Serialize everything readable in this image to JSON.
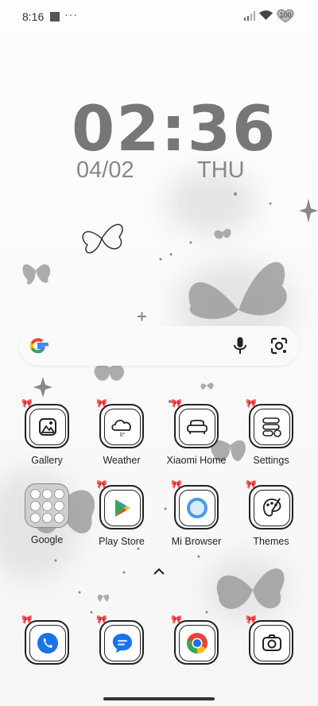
{
  "status_bar": {
    "time": "8:16",
    "more": "···",
    "battery": "100"
  },
  "clock": {
    "time": "02:36",
    "date": "04/02",
    "day": "THU"
  },
  "apps": [
    {
      "label": "Gallery"
    },
    {
      "label": "Weather",
      "temp": "0°"
    },
    {
      "label": "Xiaomi Home"
    },
    {
      "label": "Settings"
    },
    {
      "label": "Google"
    },
    {
      "label": "Play Store"
    },
    {
      "label": "Mi Browser"
    },
    {
      "label": "Themes"
    }
  ],
  "icon_names": [
    "google-g-icon",
    "mic-icon",
    "lens-icon",
    "phone-icon",
    "messages-icon",
    "chrome-icon",
    "camera-icon",
    "chevron-up-icon"
  ]
}
